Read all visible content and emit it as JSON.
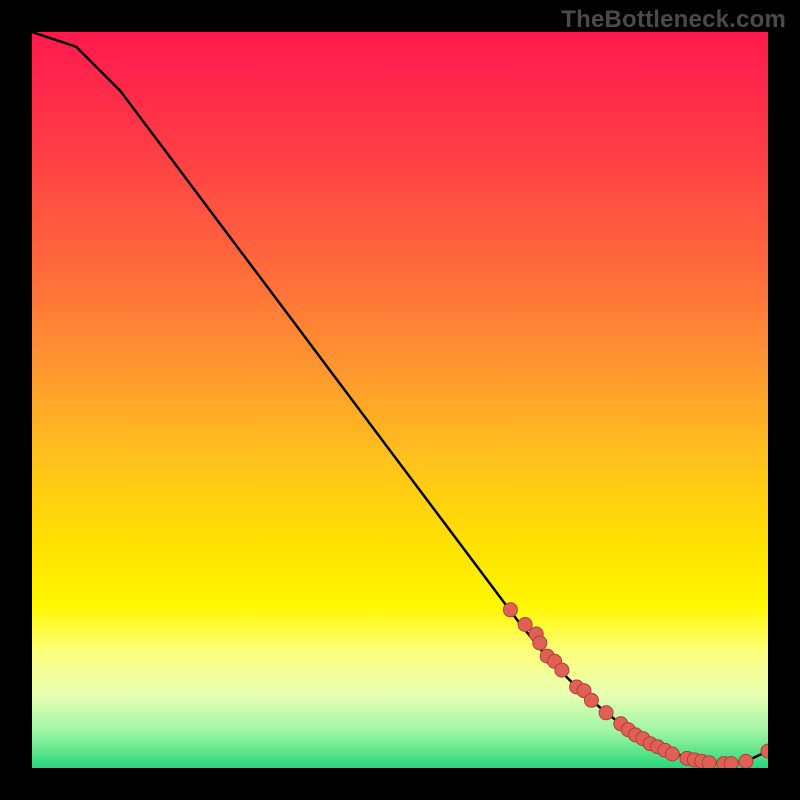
{
  "watermark": "TheBottleneck.com",
  "colors": {
    "curve": "#000000",
    "marker_fill": "#e06055",
    "marker_stroke": "#b04038",
    "background_black": "#000000",
    "gradient_top": "#ff1a4d",
    "gradient_bottom": "#28d87a"
  },
  "chart_data": {
    "type": "line",
    "title": "",
    "xlabel": "",
    "ylabel": "",
    "xlim": [
      0,
      100
    ],
    "ylim": [
      0,
      100
    ],
    "series": [
      {
        "name": "curve",
        "x": [
          0,
          6,
          12,
          18,
          24,
          30,
          36,
          42,
          48,
          54,
          60,
          66,
          70,
          74,
          78,
          82,
          86,
          90,
          94,
          97,
          100
        ],
        "y": [
          100,
          98,
          92,
          84,
          76,
          68,
          60,
          52,
          44,
          36,
          28,
          20,
          15,
          11,
          7.5,
          4.5,
          2.4,
          1.1,
          0.6,
          0.9,
          2.3
        ]
      },
      {
        "name": "markers",
        "x": [
          65,
          67,
          68.5,
          69,
          70,
          71,
          72,
          74,
          75,
          76,
          78,
          80,
          81,
          82,
          83,
          84,
          85,
          86,
          87,
          89,
          90,
          91,
          92,
          94,
          95,
          97,
          100
        ],
        "y": [
          21.5,
          19.5,
          18.2,
          17.0,
          15.2,
          14.5,
          13.3,
          11.0,
          10.5,
          9.2,
          7.5,
          6.0,
          5.2,
          4.5,
          4.0,
          3.3,
          2.9,
          2.4,
          1.9,
          1.3,
          1.1,
          0.9,
          0.7,
          0.6,
          0.6,
          0.9,
          2.3
        ]
      }
    ]
  }
}
